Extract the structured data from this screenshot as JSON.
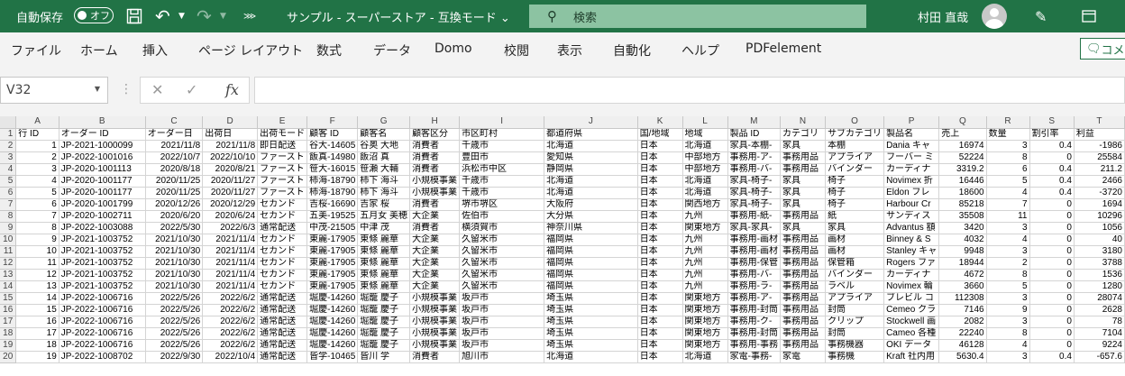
{
  "titlebar": {
    "autosave_label": "自動保存",
    "autosave_state": "オフ",
    "document_title": "サンプル - スーパーストア  -  互換モード ⌄",
    "search_placeholder": "検索",
    "user_name": "村田 直哉",
    "accent_color": "#217346"
  },
  "menu": [
    "ファイル",
    "ホーム",
    "挿入",
    "ページ レイアウト",
    "数式",
    "データ",
    "Domo",
    "校閲",
    "表示",
    "自動化",
    "ヘルプ",
    "PDFelement"
  ],
  "comment_label": "コメント",
  "formula_bar": {
    "name_box": "V32",
    "formula": ""
  },
  "sheet": {
    "columns": [
      "A",
      "B",
      "C",
      "D",
      "E",
      "F",
      "G",
      "H",
      "I",
      "J",
      "K",
      "L",
      "M",
      "N",
      "O",
      "P",
      "Q",
      "R",
      "S",
      "T"
    ],
    "headers": [
      "行 ID",
      "オーダー ID",
      "オーダー日",
      "出荷日",
      "出荷モード",
      "顧客 ID",
      "顧客名",
      "顧客区分",
      "市区町村",
      "都道府県",
      "国/地域",
      "地域",
      "製品 ID",
      "カテゴリ",
      "サブカテゴリ",
      "製品名",
      "売上",
      "数量",
      "割引率",
      "利益"
    ],
    "rows": [
      [
        "1",
        "JP-2021-1000099",
        "2021/11/8",
        "2021/11/8",
        "即日配送",
        "谷大-14605",
        "谷奥 大地",
        "消費者",
        "千歳市",
        "北海道",
        "日本",
        "北海道",
        "家具-本棚-",
        "家具",
        "本棚",
        "Dania キャ",
        "16974",
        "3",
        "0.4",
        "-1986"
      ],
      [
        "2",
        "JP-2022-1001016",
        "2022/10/7",
        "2022/10/10",
        "ファースト",
        "飯真-14980",
        "飯沼 真",
        "消費者",
        "豊田市",
        "愛知県",
        "日本",
        "中部地方",
        "事務用-ア-",
        "事務用品",
        "アプライア",
        "フーバー ミ",
        "52224",
        "8",
        "0",
        "25584"
      ],
      [
        "3",
        "JP-2020-1001113",
        "2020/8/18",
        "2020/8/21",
        "ファースト",
        "笹大-16015",
        "笹瀬 大輔",
        "消費者",
        "浜松市中区",
        "静岡県",
        "日本",
        "中部地方",
        "事務用-バ-",
        "事務用品",
        "バインダー",
        "カーディナ",
        "3319.2",
        "6",
        "0.4",
        "211.2"
      ],
      [
        "4",
        "JP-2020-1001177",
        "2020/11/25",
        "2020/11/27",
        "ファースト",
        "柿海-18790",
        "柿下 海斗",
        "小規模事業",
        "千歳市",
        "北海道",
        "日本",
        "北海道",
        "家具-椅子-",
        "家具",
        "椅子",
        "Novimex 折",
        "16446",
        "5",
        "0.4",
        "2466"
      ],
      [
        "5",
        "JP-2020-1001177",
        "2020/11/25",
        "2020/11/27",
        "ファースト",
        "柿海-18790",
        "柿下 海斗",
        "小規模事業",
        "千歳市",
        "北海道",
        "日本",
        "北海道",
        "家具-椅子-",
        "家具",
        "椅子",
        "Eldon フレ",
        "18600",
        "4",
        "0.4",
        "-3720"
      ],
      [
        "6",
        "JP-2020-1001799",
        "2020/12/26",
        "2020/12/29",
        "セカンド",
        "吉桜-16690",
        "吉家 桜",
        "消費者",
        "堺市堺区",
        "大阪府",
        "日本",
        "関西地方",
        "家具-椅子-",
        "家具",
        "椅子",
        "Harbour Cr",
        "85218",
        "7",
        "0",
        "1694"
      ],
      [
        "7",
        "JP-2020-1002711",
        "2020/6/20",
        "2020/6/24",
        "セカンド",
        "五美-19525",
        "五月女 美穂",
        "大企業",
        "佐伯市",
        "大分県",
        "日本",
        "九州",
        "事務用-紙-",
        "事務用品",
        "紙",
        "サンディス",
        "35508",
        "11",
        "0",
        "10296"
      ],
      [
        "8",
        "JP-2022-1003088",
        "2022/5/30",
        "2022/6/3",
        "通常配送",
        "中茂-21505",
        "中津 茂",
        "消費者",
        "横須賀市",
        "神奈川県",
        "日本",
        "関東地方",
        "家具-家具-",
        "家具",
        "家具",
        "Advantus 額",
        "3420",
        "3",
        "0",
        "1056"
      ],
      [
        "9",
        "JP-2021-1003752",
        "2021/10/30",
        "2021/11/4",
        "セカンド",
        "東麗-17905",
        "東條 麗華",
        "大企業",
        "久留米市",
        "福岡県",
        "日本",
        "九州",
        "事務用-画材",
        "事務用品",
        "画材",
        "Binney & S",
        "4032",
        "4",
        "0",
        "40"
      ],
      [
        "10",
        "JP-2021-1003752",
        "2021/10/30",
        "2021/11/4",
        "セカンド",
        "東麗-17905",
        "東條 麗華",
        "大企業",
        "久留米市",
        "福岡県",
        "日本",
        "九州",
        "事務用-画材",
        "事務用品",
        "画材",
        "Stanley キャ",
        "9948",
        "3",
        "0",
        "3180"
      ],
      [
        "11",
        "JP-2021-1003752",
        "2021/10/30",
        "2021/11/4",
        "セカンド",
        "東麗-17905",
        "東條 麗華",
        "大企業",
        "久留米市",
        "福岡県",
        "日本",
        "九州",
        "事務用-保管",
        "事務用品",
        "保管箱",
        "Rogers ファ",
        "18944",
        "2",
        "0",
        "3788"
      ],
      [
        "12",
        "JP-2021-1003752",
        "2021/10/30",
        "2021/11/4",
        "セカンド",
        "東麗-17905",
        "東條 麗華",
        "大企業",
        "久留米市",
        "福岡県",
        "日本",
        "九州",
        "事務用-バ-",
        "事務用品",
        "バインダー",
        "カーディナ",
        "4672",
        "8",
        "0",
        "1536"
      ],
      [
        "13",
        "JP-2021-1003752",
        "2021/10/30",
        "2021/11/4",
        "セカンド",
        "東麗-17905",
        "東條 麗華",
        "大企業",
        "久留米市",
        "福岡県",
        "日本",
        "九州",
        "事務用-ラ-",
        "事務用品",
        "ラベル",
        "Novimex 輪",
        "3660",
        "5",
        "0",
        "1280"
      ],
      [
        "14",
        "JP-2022-1006716",
        "2022/5/26",
        "2022/6/2",
        "通常配送",
        "堀慶-14260",
        "堀籠 慶子",
        "小規模事業",
        "坂戸市",
        "埼玉県",
        "日本",
        "関東地方",
        "事務用-ア-",
        "事務用品",
        "アプライア",
        "ブレビル コ",
        "112308",
        "3",
        "0",
        "28074"
      ],
      [
        "15",
        "JP-2022-1006716",
        "2022/5/26",
        "2022/6/2",
        "通常配送",
        "堀慶-14260",
        "堀籠 慶子",
        "小規模事業",
        "坂戸市",
        "埼玉県",
        "日本",
        "関東地方",
        "事務用-封筒",
        "事務用品",
        "封筒",
        "Cemeo クラ",
        "7146",
        "9",
        "0",
        "2628"
      ],
      [
        "16",
        "JP-2022-1006716",
        "2022/5/26",
        "2022/6/2",
        "通常配送",
        "堀慶-14260",
        "堀籠 慶子",
        "小規模事業",
        "坂戸市",
        "埼玉県",
        "日本",
        "関東地方",
        "事務用-ク-",
        "事務用品",
        "クリップ",
        "Stockwell 画",
        "2082",
        "3",
        "0",
        "78"
      ],
      [
        "17",
        "JP-2022-1006716",
        "2022/5/26",
        "2022/6/2",
        "通常配送",
        "堀慶-14260",
        "堀籠 慶子",
        "小規模事業",
        "坂戸市",
        "埼玉県",
        "日本",
        "関東地方",
        "事務用-封筒",
        "事務用品",
        "封筒",
        "Cameo 各種",
        "22240",
        "8",
        "0",
        "7104"
      ],
      [
        "18",
        "JP-2022-1006716",
        "2022/5/26",
        "2022/6/2",
        "通常配送",
        "堀慶-14260",
        "堀籠 慶子",
        "小規模事業",
        "坂戸市",
        "埼玉県",
        "日本",
        "関東地方",
        "事務用-事務",
        "事務用品",
        "事務機器",
        "OKI データ",
        "46128",
        "4",
        "0",
        "9224"
      ],
      [
        "19",
        "JP-2022-1008702",
        "2022/9/30",
        "2022/10/4",
        "通常配送",
        "皆学-10465",
        "皆川 学",
        "消費者",
        "旭川市",
        "北海道",
        "日本",
        "北海道",
        "家電-事務-",
        "家電",
        "事務機",
        "Kraft 社内用",
        "5630.4",
        "3",
        "0.4",
        "-657.6"
      ]
    ]
  }
}
